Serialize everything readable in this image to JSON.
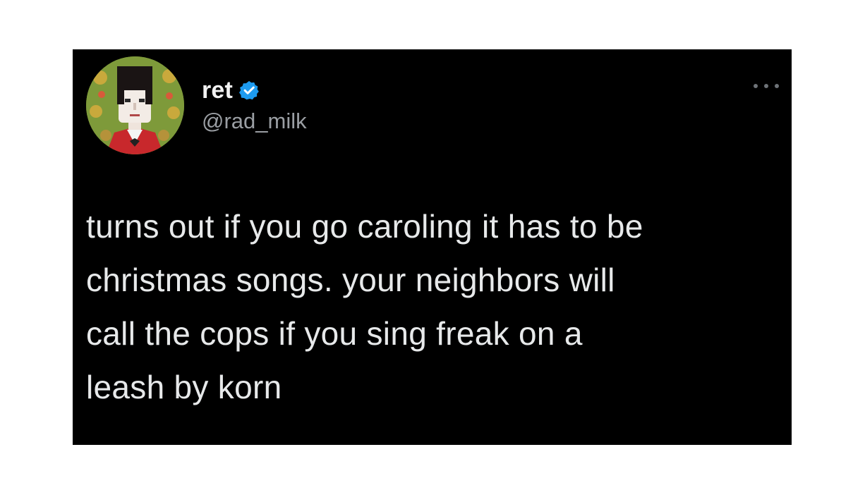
{
  "tweet": {
    "display_name": "ret",
    "handle": "@rad_milk",
    "verified": true,
    "verified_icon": "verified-badge-icon",
    "more_icon": "more-options-icon",
    "text": "turns out if you go caroling it has to be\nchristmas songs. your neighbors will\ncall the cops if you sing freak on a\nleash by korn"
  },
  "colors": {
    "card_background": "#000000",
    "text": "#e7e9ea",
    "handle": "#9a9ea3",
    "verified": "#1d9bf0"
  }
}
